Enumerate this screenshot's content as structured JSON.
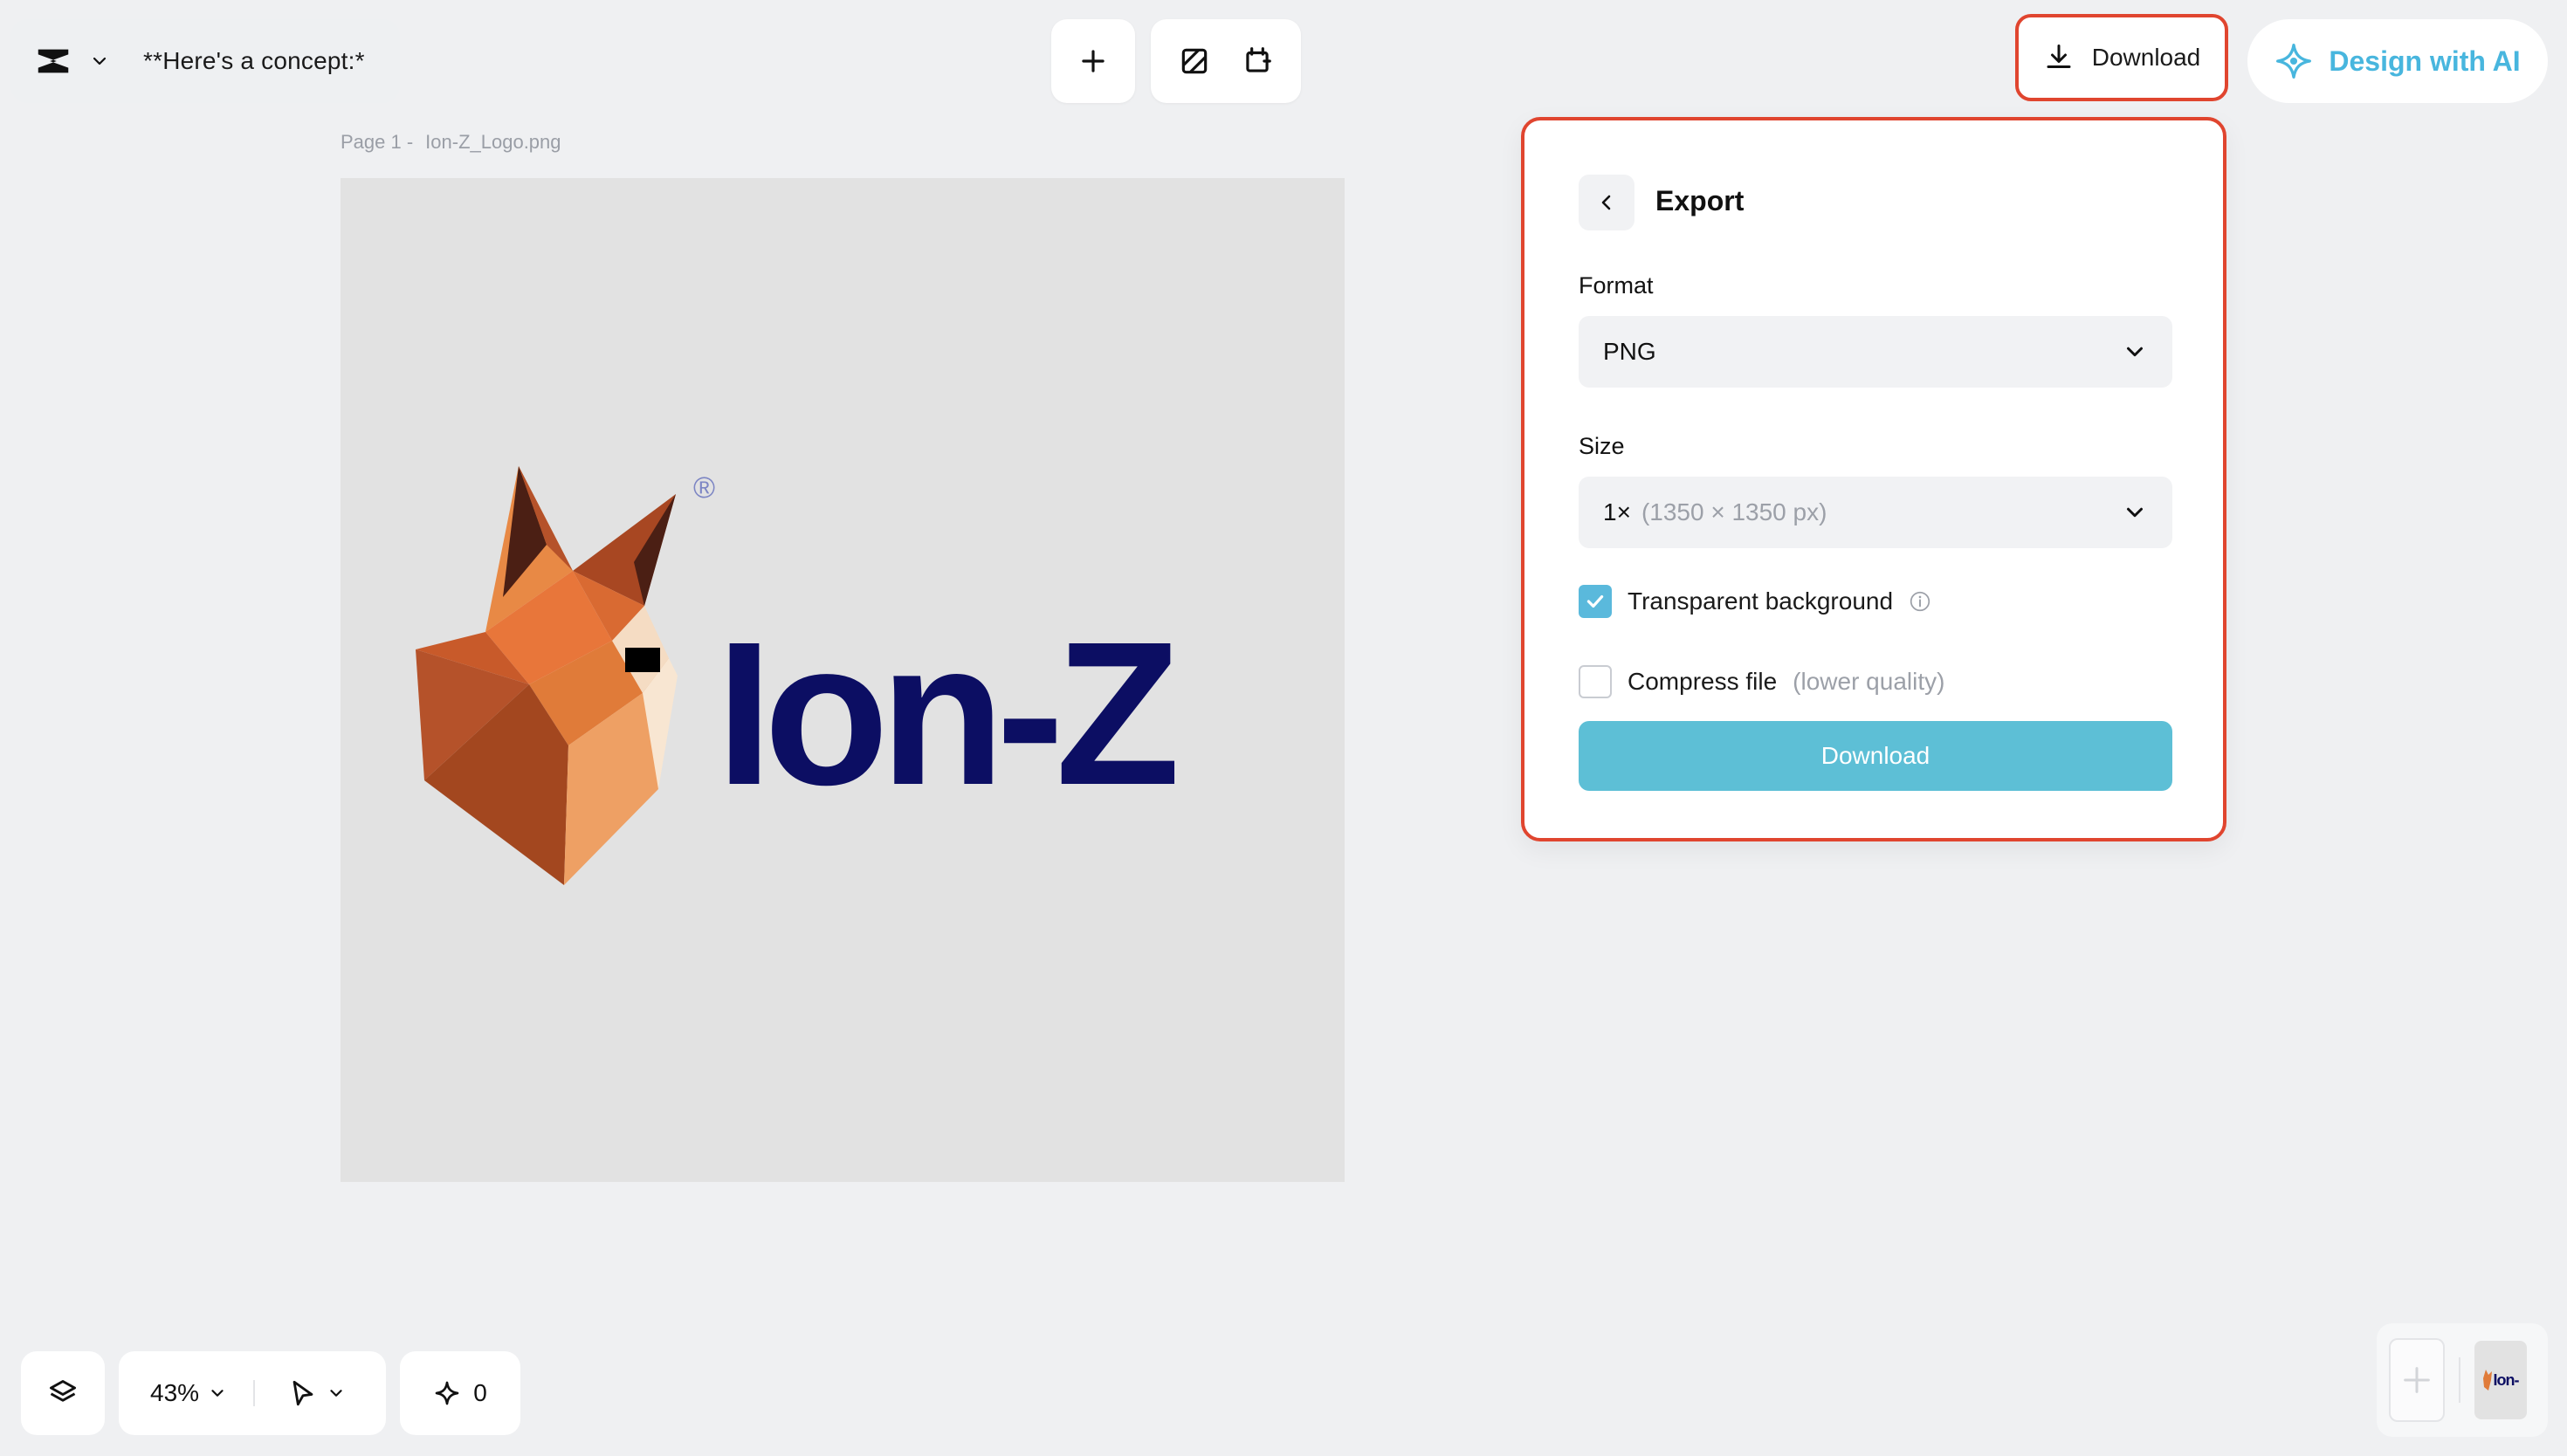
{
  "header": {
    "doc_title": "**Here's a concept:*",
    "download_label": "Download",
    "ai_label": "Design with AI"
  },
  "canvas": {
    "page_label": "Page 1 -",
    "file_name": "Ion-Z_Logo.png",
    "wordmark": "Ion-Z",
    "registered": "®"
  },
  "export": {
    "title": "Export",
    "format_label": "Format",
    "format_value": "PNG",
    "size_label": "Size",
    "size_value": "1×",
    "size_detail": "(1350 × 1350 px)",
    "transparent_label": "Transparent background",
    "transparent_checked": true,
    "compress_label": "Compress file",
    "compress_hint": "(lower quality)",
    "compress_checked": false,
    "download_label": "Download"
  },
  "bottom": {
    "zoom": "43%",
    "ai_credits": "0",
    "thumb_text": "Ion-"
  },
  "colors": {
    "accent": "#5dbfd6",
    "ai_blue": "#48b6de",
    "highlight": "#e0452f",
    "wordmark": "#0c0e63",
    "fox_orange": "#e07b39"
  },
  "icons": [
    "capcut-logo-icon",
    "chevron-down-icon",
    "plus-icon",
    "resize-icon",
    "crop-icon",
    "download-icon",
    "ai-sparkle-icon",
    "back-chevron-icon",
    "check-icon",
    "info-icon",
    "layers-icon",
    "pointer-icon",
    "sparkle-icon"
  ]
}
